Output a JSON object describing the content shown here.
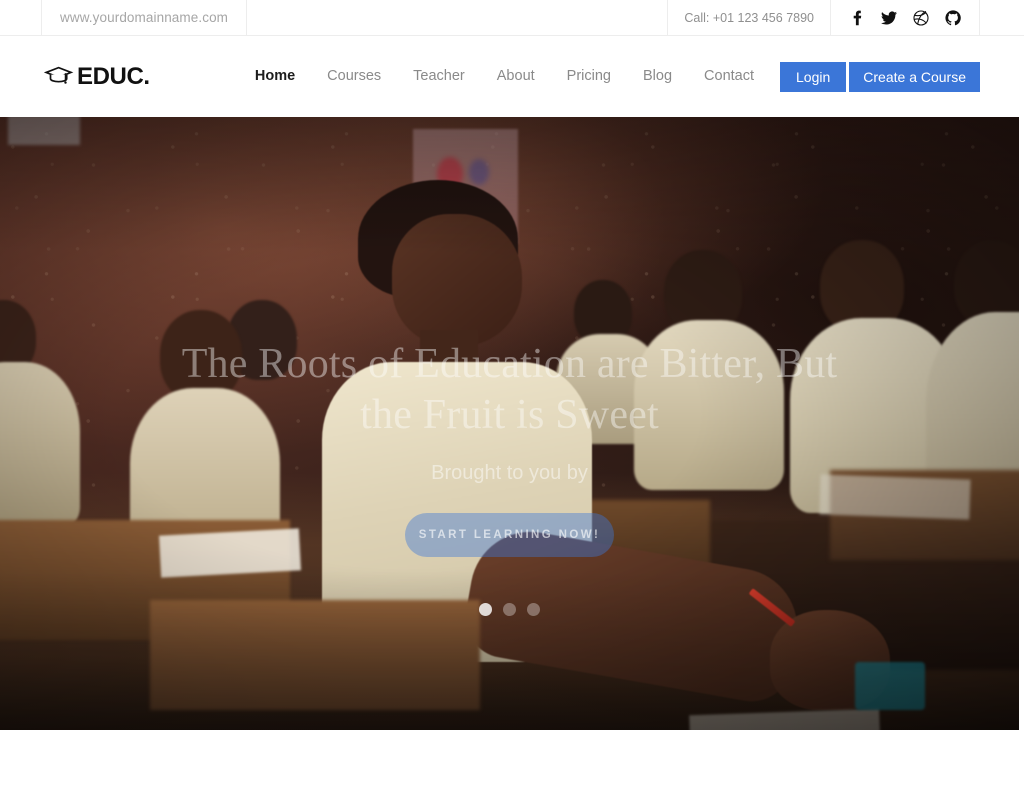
{
  "topbar": {
    "domain": "www.yourdomainname.com",
    "phone": "Call: +01 123 456 7890",
    "social": [
      {
        "name": "facebook-icon",
        "label": "Facebook"
      },
      {
        "name": "twitter-icon",
        "label": "Twitter"
      },
      {
        "name": "dribbble-icon",
        "label": "Dribbble"
      },
      {
        "name": "github-icon",
        "label": "GitHub"
      }
    ]
  },
  "header": {
    "logo_icon": "graduation-cap-icon",
    "logo_text": "EDUC.",
    "nav": [
      {
        "label": "Home",
        "active": true
      },
      {
        "label": "Courses",
        "active": false
      },
      {
        "label": "Teacher",
        "active": false
      },
      {
        "label": "About",
        "active": false
      },
      {
        "label": "Pricing",
        "active": false
      },
      {
        "label": "Blog",
        "active": false
      },
      {
        "label": "Contact",
        "active": false
      }
    ],
    "login_label": "Login",
    "create_course_label": "Create a Course",
    "accent_color": "#3b76d8"
  },
  "hero": {
    "title": "The Roots of Education are Bitter, But the Fruit is Sweet",
    "subtitle": "Brought to you by",
    "cta_label": "START LEARNING NOW!",
    "slides": [
      {
        "index": 1,
        "active": true
      },
      {
        "index": 2,
        "active": false
      },
      {
        "index": 3,
        "active": false
      }
    ],
    "background_description": "Classroom with students at wooden desks"
  }
}
